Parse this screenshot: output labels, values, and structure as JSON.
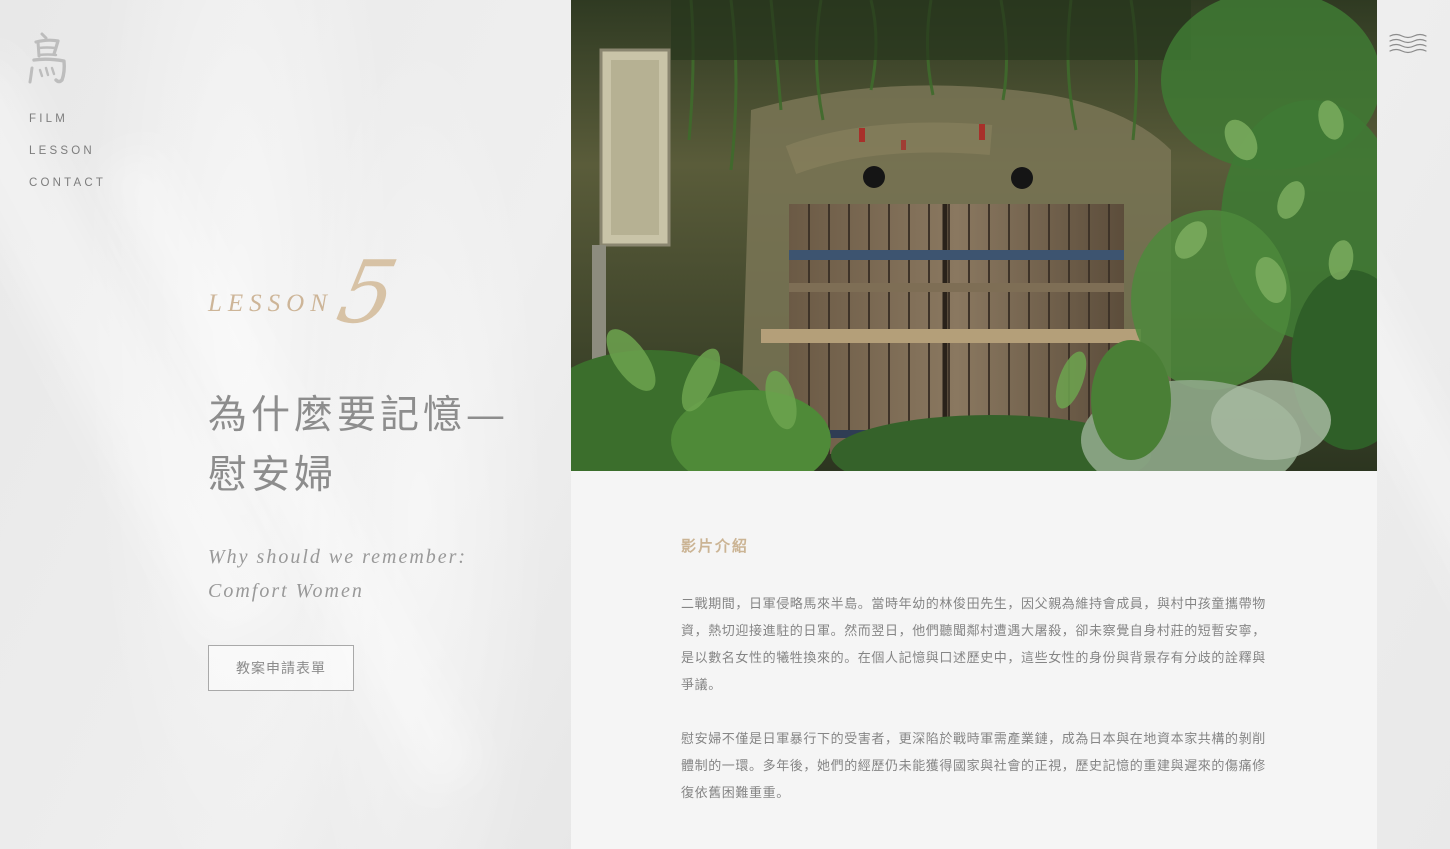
{
  "brand": {
    "logo_glyph": "島"
  },
  "nav": {
    "items": [
      {
        "label": "FILM"
      },
      {
        "label": "LESSON"
      },
      {
        "label": "CONTACT"
      }
    ]
  },
  "hero": {
    "lesson_label": "LESSON",
    "lesson_number": "5",
    "title_zh_line1": "為什麼要記憶—",
    "title_zh_line2": "慰安婦",
    "title_en_line1": "Why should we remember:",
    "title_en_line2": "Comfort Women",
    "apply_button": "教案申請表單"
  },
  "intro": {
    "heading": "影片介紹",
    "paragraph1": "二戰期間，日軍侵略馬來半島。當時年幼的林俊田先生，因父親為維持會成員，與村中孩童攜帶物資，熱切迎接進駐的日軍。然而翌日，他們聽聞鄰村遭遇大屠殺，卻未察覺自身村莊的短暫安寧，是以數名女性的犧牲換來的。在個人記憶與口述歷史中，這些女性的身份與背景存有分歧的詮釋與爭議。",
    "paragraph2": "慰安婦不僅是日軍暴行下的受害者，更深陷於戰時軍需產業鏈，成為日本與在地資本家共構的剝削體制的一環。多年後，她們的經歷仍未能獲得國家與社會的正視，歷史記憶的重建與遲來的傷痛修復依舊困難重重。"
  },
  "colors": {
    "accent_gold": "#cdb598",
    "text_gray": "#858585",
    "panel_bg": "#f5f5f5"
  },
  "icons": {
    "menu": "hamburger-wave-icon",
    "photo": "overgrown-wooden-door-photo"
  }
}
